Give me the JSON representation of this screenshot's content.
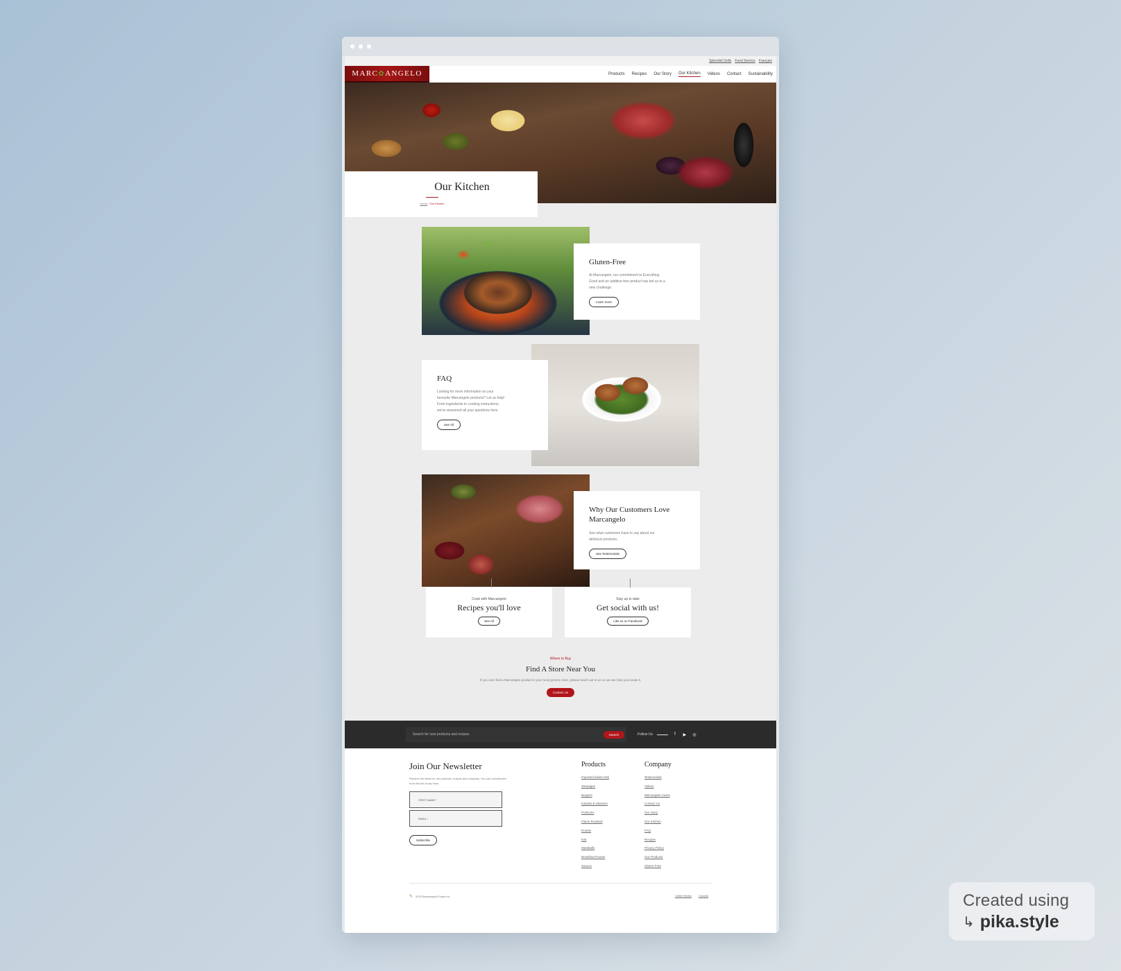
{
  "utility_links": [
    "Splendid Grills",
    "Food Service",
    "Français"
  ],
  "brand": {
    "logo": "MARC",
    "logo_mid": "✿",
    "logo_end": "ANGELO"
  },
  "nav": [
    "Products",
    "Recipes",
    "Our Story",
    "Our Kitchen",
    "Videos",
    "Contact",
    "Sustainability"
  ],
  "nav_active": "Our Kitchen",
  "hero": {
    "title": "Our Kitchen",
    "crumb_home": "Home",
    "crumb_sep": "/",
    "crumb_current": "Our Kitchen"
  },
  "features": {
    "gluten": {
      "title": "Gluten-Free",
      "body": "At Marcangelo, our commitment to Everything Good and an additive-free product has led us to a new challenge.",
      "button": "Learn more"
    },
    "faq": {
      "title": "FAQ",
      "body": "Looking for more information on your favourite Marcangelo products? Let us help! From ingredients to cooking instructions, we've answered all your questions here.",
      "button": "See All"
    },
    "customers": {
      "title": "Why Our Customers Love Marcangelo",
      "body": "See what customers have to say about our delicious products.",
      "button": "See Testimonials"
    }
  },
  "promos": {
    "recipes": {
      "eyebrow": "Cook with Marcangelo",
      "title": "Recipes you'll love",
      "button": "See All"
    },
    "social": {
      "eyebrow": "Stay up to date",
      "title": "Get social with us!",
      "button": "Like us on Facebook"
    }
  },
  "store": {
    "eyebrow": "Where to Buy",
    "title": "Find A Store Near You",
    "body": "If you can't find a Marcangelo product in your local grocery store, please reach out to us so we can help you locate it.",
    "button": "Contact Us"
  },
  "search": {
    "placeholder": "Search for new products and recipes",
    "button": "Search",
    "follow": "Follow Us"
  },
  "social_icons": [
    "facebook-icon",
    "youtube-icon",
    "instagram-icon"
  ],
  "newsletter": {
    "title": "Join Our Newsletter",
    "body": "Receive the latest on our products, recipes and company. You can unsubscribe from this list at any time.",
    "first_name": "FIRST NAME *",
    "email": "EMAIL *",
    "button": "Subscribe"
  },
  "footer_products": {
    "title": "Products",
    "links": [
      "Imported Italian Deli",
      "Sausages",
      "Burgers",
      "Kabobs & Skewers",
      "Porkloins",
      "Flame Roasted",
      "Roasts",
      "Kits",
      "Meatballs",
      "Breakfast Roasts",
      "Sauces"
    ]
  },
  "footer_company": {
    "title": "Company",
    "links": [
      "Testimonials",
      "Videos",
      "Marcangelo Cares",
      "Contact Us",
      "Our Story",
      "Our Kitchen",
      "FAQ",
      "Recipes",
      "Privacy Policy",
      "Our Products",
      "Gluten-Free"
    ]
  },
  "copyright": "2023 Marcangelo Foods Inc",
  "regions": [
    "United States",
    "Canada"
  ],
  "badge": {
    "line1": "Created using",
    "line2": "pika.style"
  },
  "colors": {
    "brand_red": "#b1161b",
    "dark_bar": "#2b2b2b",
    "page_bg": "#ececec"
  }
}
